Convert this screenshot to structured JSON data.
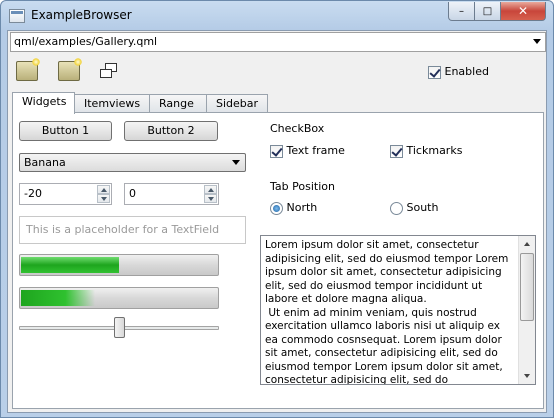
{
  "window": {
    "title": "ExampleBrowser",
    "close_glyph": "✕",
    "minimize_glyph": "–",
    "maximize_glyph": "□"
  },
  "url_combo": {
    "value": "qml/examples/Gallery.qml"
  },
  "toolbar": {
    "icons": [
      "open-folder-icon",
      "new-folder-icon",
      "window-restore-icon"
    ],
    "enabled_label": "Enabled",
    "enabled_checked": true
  },
  "tabs": [
    "Widgets",
    "Itemviews",
    "Range",
    "Sidebar"
  ],
  "active_tab": "Widgets",
  "widgets": {
    "button1": "Button 1",
    "button2": "Button 2",
    "fruit_combo": "Banana",
    "spin1": "-20",
    "spin2": "0",
    "textfield_placeholder": "This is a placeholder for a TextField",
    "progress1_fraction": 0.5,
    "progress2_fraction": 0.38,
    "slider_fraction": 0.5
  },
  "checkbox_group": {
    "title": "CheckBox",
    "text_frame": "Text frame",
    "text_frame_checked": true,
    "tickmarks": "Tickmarks",
    "tickmarks_checked": true
  },
  "tab_position": {
    "title": "Tab Position",
    "north": "North",
    "south": "South",
    "selected": "North"
  },
  "textarea": {
    "text": "Lorem ipsum dolor sit amet, consectetur adipisicing elit, sed do eiusmod tempor Lorem ipsum dolor sit amet, consectetur adipisicing elit, sed do eiusmod tempor incididunt ut labore et dolore magna aliqua.\n Ut enim ad minim veniam, quis nostrud exercitation ullamco laboris nisi ut aliquip ex ea commodo cosnsequat. Lorem ipsum dolor sit amet, consectetur adipisicing elit, sed do eiusmod tempor Lorem ipsum dolor sit amet, consectetur adipisicing elit, sed do"
  }
}
